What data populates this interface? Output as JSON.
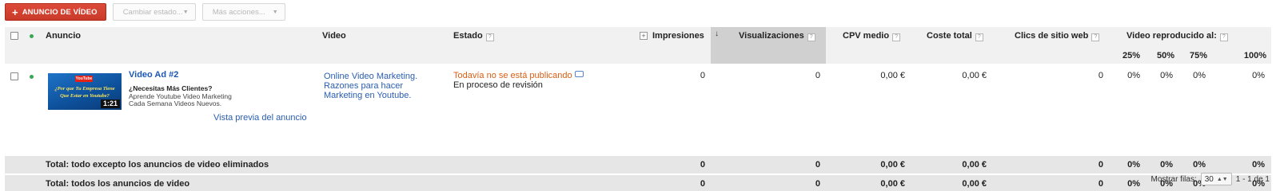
{
  "toolbar": {
    "new_video_ad_label": "ANUNCIO DE VÍDEO",
    "change_status_label": "Cambiar estado...",
    "more_actions_label": "Más acciones..."
  },
  "headers": {
    "ad": "Anuncio",
    "video": "Video",
    "status": "Estado",
    "impressions": "Impresiones",
    "views": "Visualizaciones",
    "cpv": "CPV medio",
    "cost": "Coste total",
    "site_clicks": "Clics de sitio web",
    "played_to": "Video reproducido al:",
    "q25": "25%",
    "q50": "50%",
    "q75": "75%",
    "q100": "100%",
    "help_glyph": "?",
    "sort_arrow": "↓",
    "expand_glyph": "+"
  },
  "ad_row": {
    "thumbnail": {
      "yt_label": "YouTube",
      "line1": "¿Por que Tu Empresa Tiene",
      "line2": "Que Estar en Youtube?",
      "duration": "1:21"
    },
    "title": "Video Ad #2",
    "headline": "¿Necesitas Más Clientes?",
    "desc1": "Aprende Youtube Video Marketing",
    "desc2": "Cada Semana Videos Nuevos.",
    "preview_link": "Vista previa del anuncio",
    "video_title": "Online Video Marketing. Razones para hacer Marketing en Youtube.",
    "status_primary": "Todavía no se está publicando",
    "status_secondary": "En proceso de revisión",
    "impressions": "0",
    "views": "0",
    "cpv": "0,00 €",
    "cost": "0,00 €",
    "site_clicks": "0",
    "q25": "0%",
    "q50": "0%",
    "q75": "0%",
    "q100": "0%"
  },
  "totals": [
    {
      "label": "Total: todo excepto los anuncios de video eliminados",
      "impressions": "0",
      "views": "0",
      "cpv": "0,00 €",
      "cost": "0,00 €",
      "site_clicks": "0",
      "q25": "0%",
      "q50": "0%",
      "q75": "0%",
      "q100": "0%"
    },
    {
      "label": "Total: todos los anuncios de video",
      "impressions": "0",
      "views": "0",
      "cpv": "0,00 €",
      "cost": "0,00 €",
      "site_clicks": "0",
      "q25": "0%",
      "q50": "0%",
      "q75": "0%",
      "q100": "0%"
    }
  ],
  "footer": {
    "rows_label": "Mostrar filas:",
    "rows_value": "30",
    "range": "1 - 1 de 1"
  },
  "colors": {
    "primary_button": "#dd4b39",
    "link": "#2a5db0",
    "status_pending": "#dd5d12",
    "enabled_dot": "#3aa757",
    "sorted_column": "#d0d0d0"
  }
}
